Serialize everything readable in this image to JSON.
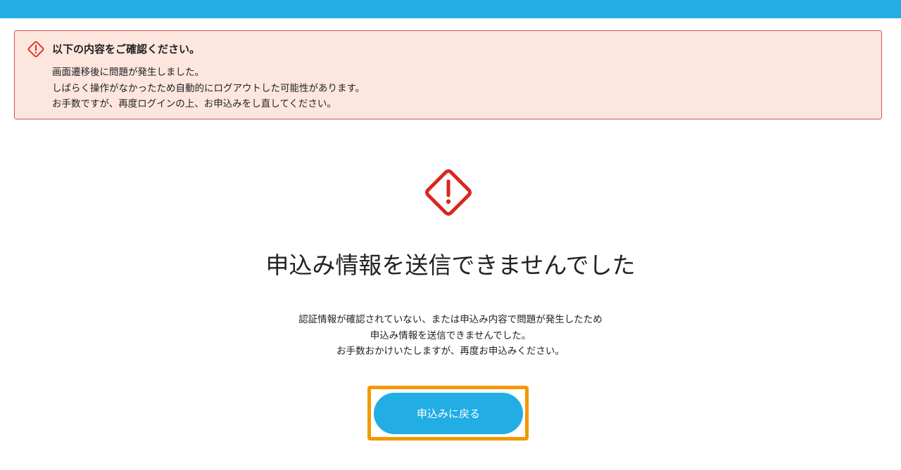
{
  "colors": {
    "topbar": "#22aee4",
    "alert_bg": "#fde6de",
    "alert_border": "#d9534a",
    "warning_red": "#d9261c",
    "button": "#22aee4",
    "focus_outline": "#f39800"
  },
  "alert": {
    "icon": "warning-diamond-icon",
    "title": "以下の内容をご確認ください。",
    "lines": [
      "画面遷移後に問題が発生しました。",
      "しばらく操作がなかったため自動的にログアウトした可能性があります。",
      "お手数ですが、再度ログインの上、お申込みをし直してください。"
    ]
  },
  "main": {
    "icon": "warning-diamond-icon",
    "heading": "申込み情報を送信できませんでした",
    "description": [
      "認証情報が確認されていない、または申込み内容で問題が発生したため",
      "申込み情報を送信できませんでした。",
      "お手数おかけいたしますが、再度お申込みください。"
    ],
    "button_label": "申込みに戻る"
  }
}
